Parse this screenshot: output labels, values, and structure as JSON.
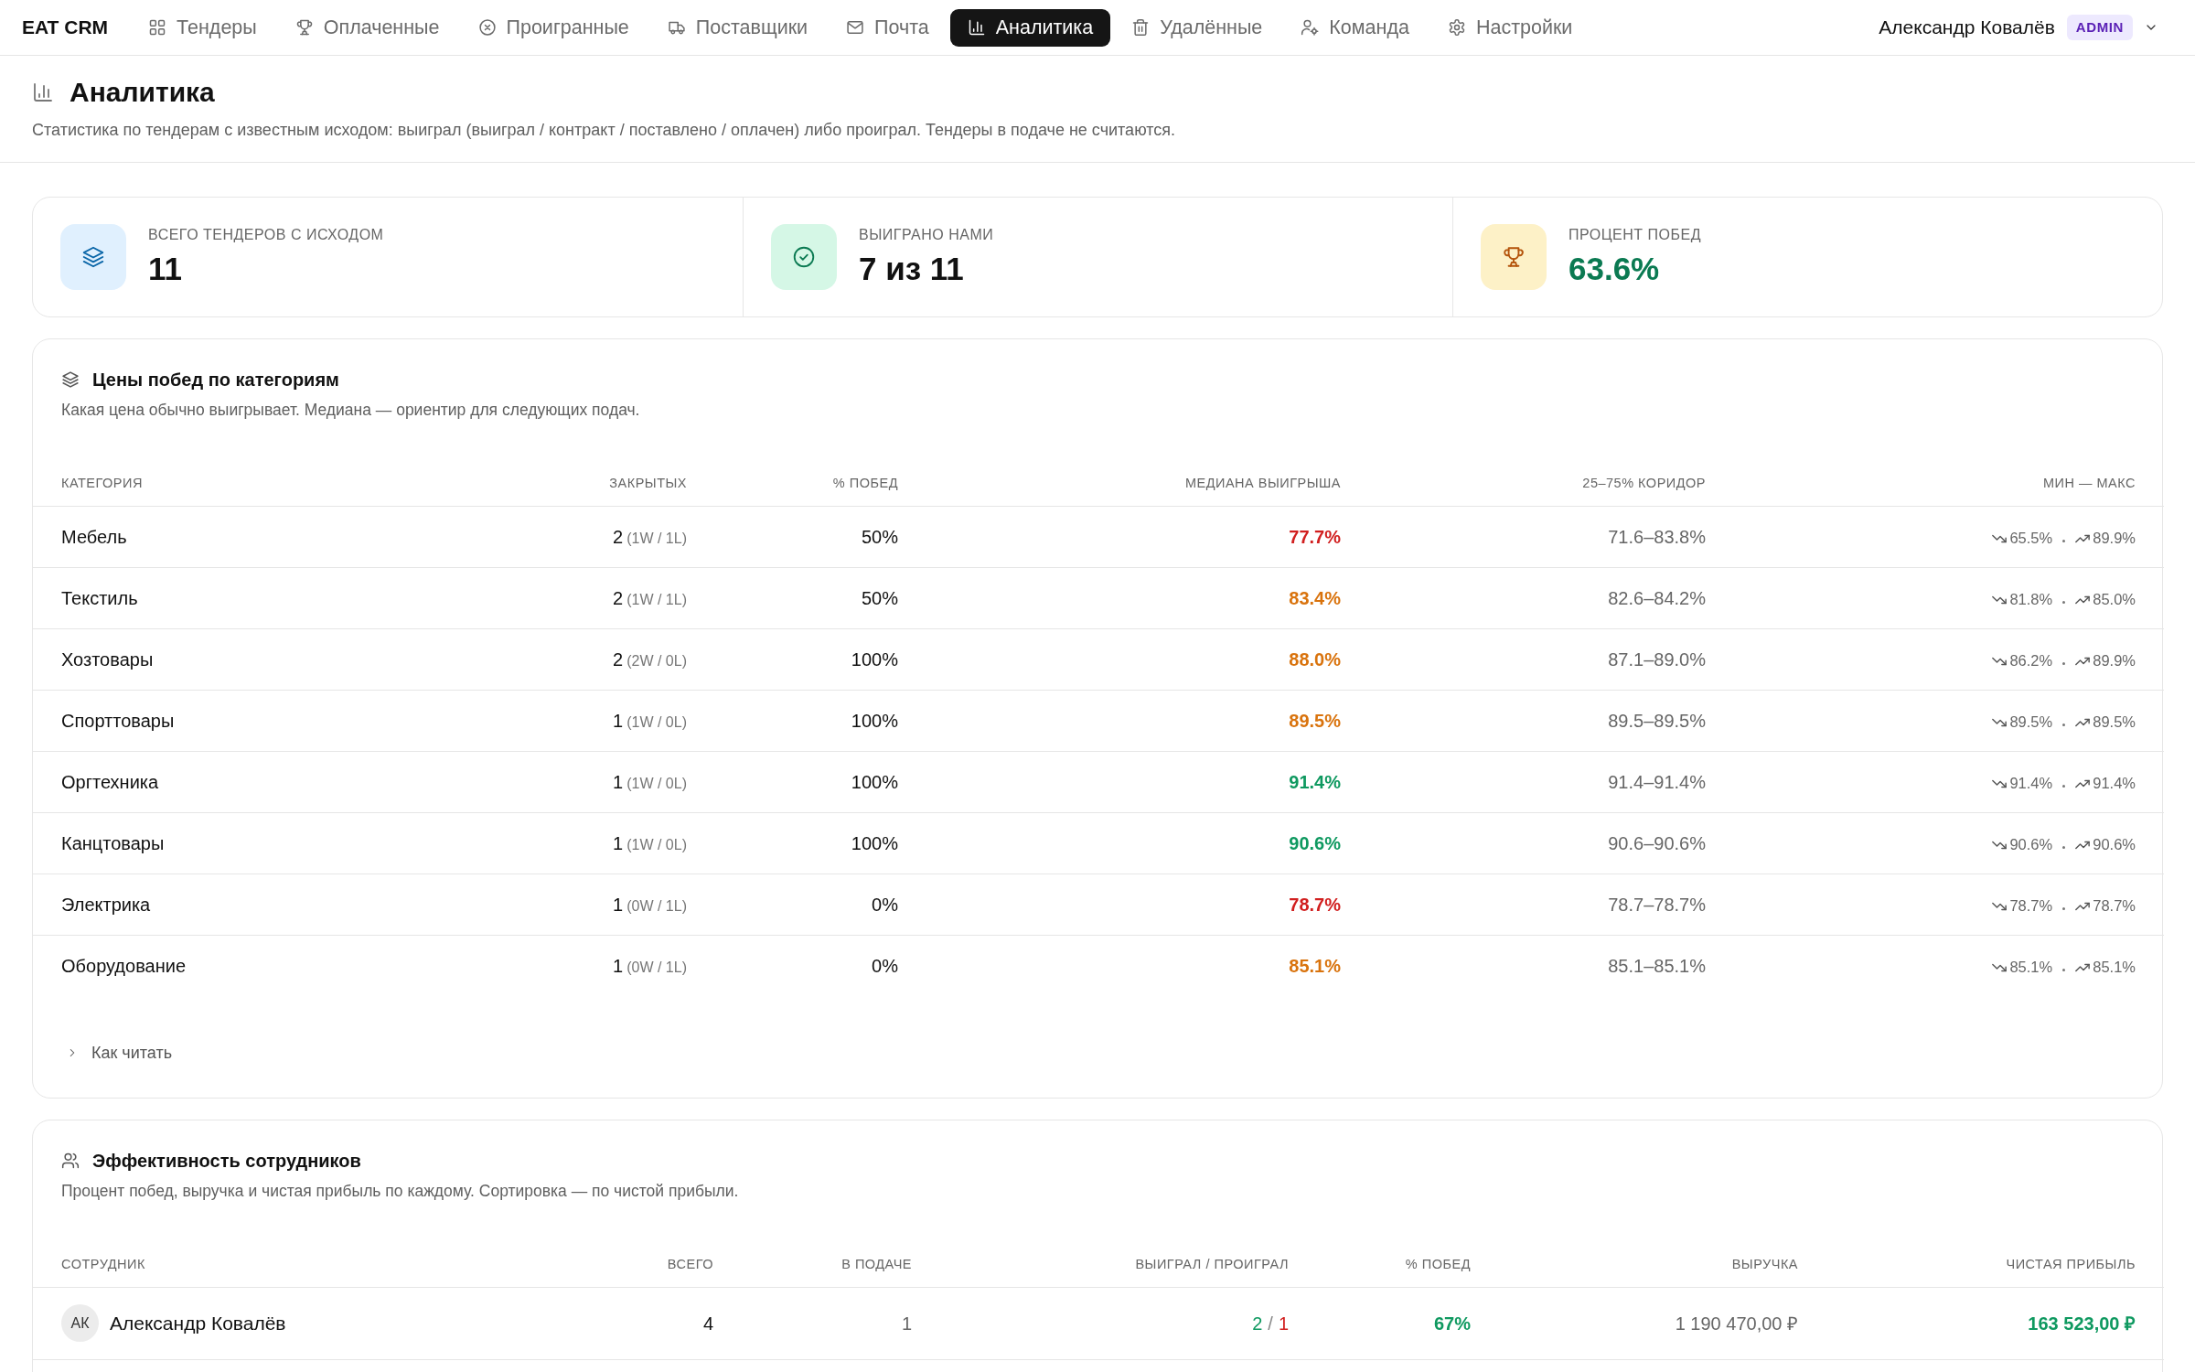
{
  "navbar": {
    "brand": "EAT CRM",
    "items": [
      {
        "label": "Тендеры",
        "selected": false
      },
      {
        "label": "Оплаченные",
        "selected": false
      },
      {
        "label": "Проигранные",
        "selected": false
      },
      {
        "label": "Поставщики",
        "selected": false
      },
      {
        "label": "Почта",
        "selected": false
      },
      {
        "label": "Аналитика",
        "selected": true
      },
      {
        "label": "Удалённые",
        "selected": false
      },
      {
        "label": "Команда",
        "selected": false
      },
      {
        "label": "Настройки",
        "selected": false
      }
    ],
    "user": {
      "name": "Александр Ковалёв",
      "role": "ADMIN"
    }
  },
  "page_header": {
    "title": "Аналитика",
    "subtitle": "Статистика по тендерам с известным исходом: выиграл (выиграл / контракт / поставлено / оплачен) либо проиграл. Тендеры в подаче не считаются."
  },
  "stats": [
    {
      "label": "ВСЕГО ТЕНДЕРОВ С ИСХОДОМ",
      "value": "11",
      "color": "#111111"
    },
    {
      "label": "ВЫИГРАНО НАМИ",
      "value": "7 из 11",
      "color": "#111111"
    },
    {
      "label": "ПРОЦЕНТ ПОБЕД",
      "value": "63.6%",
      "color": "#0b7a52"
    }
  ],
  "category_prices": {
    "title": "Цены побед по категориям",
    "description": "Какая цена обычно выигрывает. Медиана — ориентир для следующих подач.",
    "columns": [
      "КАТЕГОРИЯ",
      "ЗАКРЫТЫХ",
      "% ПОБЕД",
      "МЕДИАНА ВЫИГРЫША",
      "25–75% КОРИДОР",
      "МИН — МАКС"
    ],
    "rows": [
      {
        "category": "Мебель",
        "closed": "2",
        "closed_detail": "(1W / 1L)",
        "win_rate": "50%",
        "median": "77.7%",
        "color": "#d11f1f",
        "corridor": "71.6–83.8%",
        "min": "65.5%",
        "max": "89.9%"
      },
      {
        "category": "Текстиль",
        "closed": "2",
        "closed_detail": "(1W / 1L)",
        "win_rate": "50%",
        "median": "83.4%",
        "color": "#d9730d",
        "corridor": "82.6–84.2%",
        "min": "81.8%",
        "max": "85.0%"
      },
      {
        "category": "Хозтовары",
        "closed": "2",
        "closed_detail": "(2W / 0L)",
        "win_rate": "100%",
        "median": "88.0%",
        "color": "#d9730d",
        "corridor": "87.1–89.0%",
        "min": "86.2%",
        "max": "89.9%"
      },
      {
        "category": "Спорттовары",
        "closed": "1",
        "closed_detail": "(1W / 0L)",
        "win_rate": "100%",
        "median": "89.5%",
        "color": "#d9730d",
        "corridor": "89.5–89.5%",
        "min": "89.5%",
        "max": "89.5%"
      },
      {
        "category": "Оргтехника",
        "closed": "1",
        "closed_detail": "(1W / 0L)",
        "win_rate": "100%",
        "median": "91.4%",
        "color": "#0f9960",
        "corridor": "91.4–91.4%",
        "min": "91.4%",
        "max": "91.4%"
      },
      {
        "category": "Канцтовары",
        "closed": "1",
        "closed_detail": "(1W / 0L)",
        "win_rate": "100%",
        "median": "90.6%",
        "color": "#0f9960",
        "corridor": "90.6–90.6%",
        "min": "90.6%",
        "max": "90.6%"
      },
      {
        "category": "Электрика",
        "closed": "1",
        "closed_detail": "(0W / 1L)",
        "win_rate": "0%",
        "median": "78.7%",
        "color": "#d11f1f",
        "corridor": "78.7–78.7%",
        "min": "78.7%",
        "max": "78.7%"
      },
      {
        "category": "Оборудование",
        "closed": "1",
        "closed_detail": "(0W / 1L)",
        "win_rate": "0%",
        "median": "85.1%",
        "color": "#d9730d",
        "corridor": "85.1–85.1%",
        "min": "85.1%",
        "max": "85.1%"
      }
    ],
    "how_to_read": {
      "label": "Как читать",
      "expanded": false
    }
  },
  "employee_performance": {
    "title": "Эффективность сотрудников",
    "description": "Процент побед, выручка и чистая прибыль по каждому. Сортировка — по чистой прибыли.",
    "columns": [
      "СОТРУДНИК",
      "ВСЕГО",
      "В ПОДАЧЕ",
      "ВЫИГРАЛ / ПРОИГРАЛ",
      "% ПОБЕД",
      "ВЫРУЧКА",
      "ЧИСТАЯ ПРИБЫЛЬ"
    ],
    "rows": [
      {
        "initials": "АК",
        "name": "Александр Ковалёв",
        "total": "4",
        "in_submission": "1",
        "won": "2",
        "separator": "/",
        "lost": "1",
        "win_rate": "67%",
        "revenue": "1 190 470,00 ₽",
        "net_profit": "163 523,00 ₽"
      }
    ]
  }
}
